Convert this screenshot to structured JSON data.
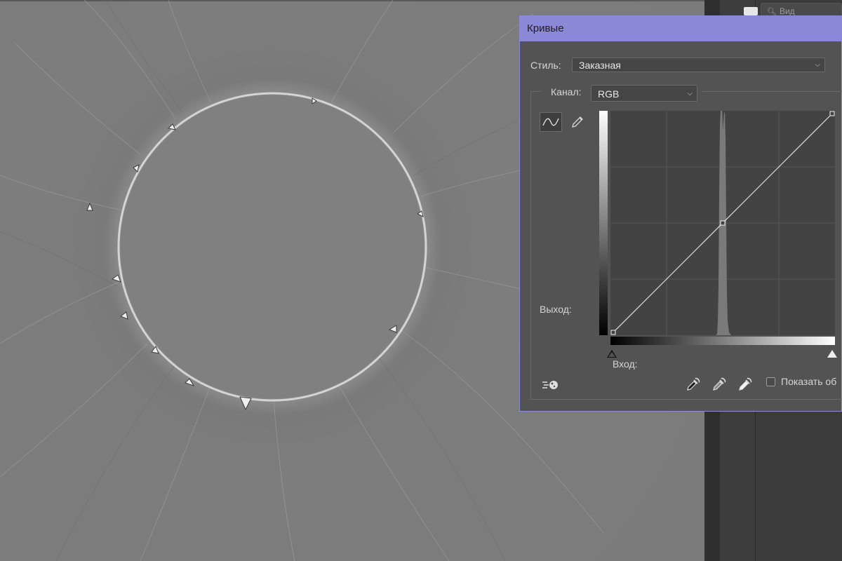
{
  "dialog": {
    "title": "Кривые",
    "style_label": "Стиль:",
    "style_value": "Заказная",
    "channel_label": "Канал:",
    "channel_value": "RGB",
    "output_label": "Выход:",
    "input_label": "Вход:",
    "show_clipping_label": "Показать об",
    "show_clipping_checked": false
  },
  "right_panel": {
    "search_placeholder": "Вид"
  },
  "curve": {
    "points": [
      [
        0,
        0
      ],
      [
        128,
        128
      ],
      [
        255,
        255
      ]
    ],
    "grid_divisions": 4
  },
  "colors": {
    "title_bar": "#8b88d8",
    "dialog_bg": "#535353",
    "graph_bg": "#434343",
    "canvas_gray": "#7c7c7c"
  },
  "icons": {
    "curve_tool": "curve-points-icon",
    "pencil_tool": "pencil-icon",
    "auto": "auto-adjust-icon",
    "eyedroppers": [
      "black-point-eyedropper-icon",
      "gray-point-eyedropper-icon",
      "white-point-eyedropper-icon"
    ],
    "search": "search-icon"
  }
}
